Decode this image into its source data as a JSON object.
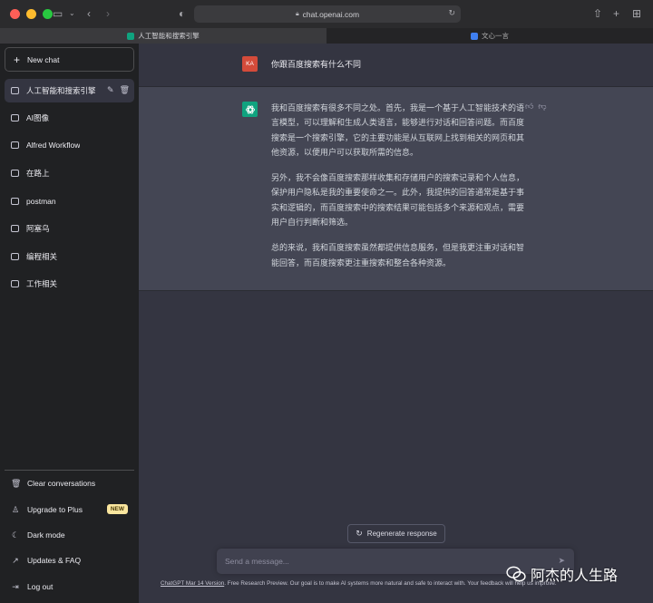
{
  "browser": {
    "url": "chat.openai.com",
    "tabs": [
      {
        "label": "人工智能和搜索引擎",
        "active": true
      },
      {
        "label": "文心一言",
        "active": false
      }
    ]
  },
  "sidebar": {
    "new_chat": "New chat",
    "conversations": [
      {
        "label": "人工智能和搜索引擎",
        "active": true
      },
      {
        "label": "AI图像"
      },
      {
        "label": "Alfred Workflow"
      },
      {
        "label": "在路上"
      },
      {
        "label": "postman"
      },
      {
        "label": "阿塞乌"
      },
      {
        "label": "编程相关"
      },
      {
        "label": "工作相关"
      }
    ],
    "bottom": [
      {
        "label": "Clear conversations",
        "icon": "trash-icon"
      },
      {
        "label": "Upgrade to Plus",
        "icon": "user-icon",
        "badge": "NEW"
      },
      {
        "label": "Dark mode",
        "icon": "moon-icon"
      },
      {
        "label": "Updates & FAQ",
        "icon": "external-link-icon"
      },
      {
        "label": "Log out",
        "icon": "logout-icon"
      }
    ]
  },
  "chat": {
    "user_avatar": "KA",
    "user_message": "你跟百度搜索有什么不同",
    "ai_paragraphs": [
      "我和百度搜索有很多不同之处。首先，我是一个基于人工智能技术的语言模型，可以理解和生成人类语言，能够进行对话和回答问题。而百度搜索是一个搜索引擎，它的主要功能是从互联网上找到相关的网页和其他资源，以便用户可以获取所需的信息。",
      "另外，我不会像百度搜索那样收集和存储用户的搜索记录和个人信息，保护用户隐私是我的重要使命之一。此外，我提供的回答通常是基于事实和逻辑的，而百度搜索中的搜索结果可能包括多个来源和观点，需要用户自行判断和筛选。",
      "总的来说，我和百度搜索虽然都提供信息服务，但是我更注重对话和智能回答，而百度搜索更注重搜索和整合各种资源。"
    ],
    "regenerate": "Regenerate response",
    "input_placeholder": "Send a message...",
    "footer_link": "ChatGPT Mar 14 Version",
    "footer_text": ". Free Research Preview. Our goal is to make AI systems more natural and safe to interact with. Your feedback will help us improve."
  },
  "watermark": "阿杰的人生路",
  "colors": {
    "sidebar_bg": "#202123",
    "main_bg": "#343541",
    "ai_row_bg": "#444654",
    "accent_green": "#10a37f",
    "user_avatar": "#d44b3a"
  }
}
